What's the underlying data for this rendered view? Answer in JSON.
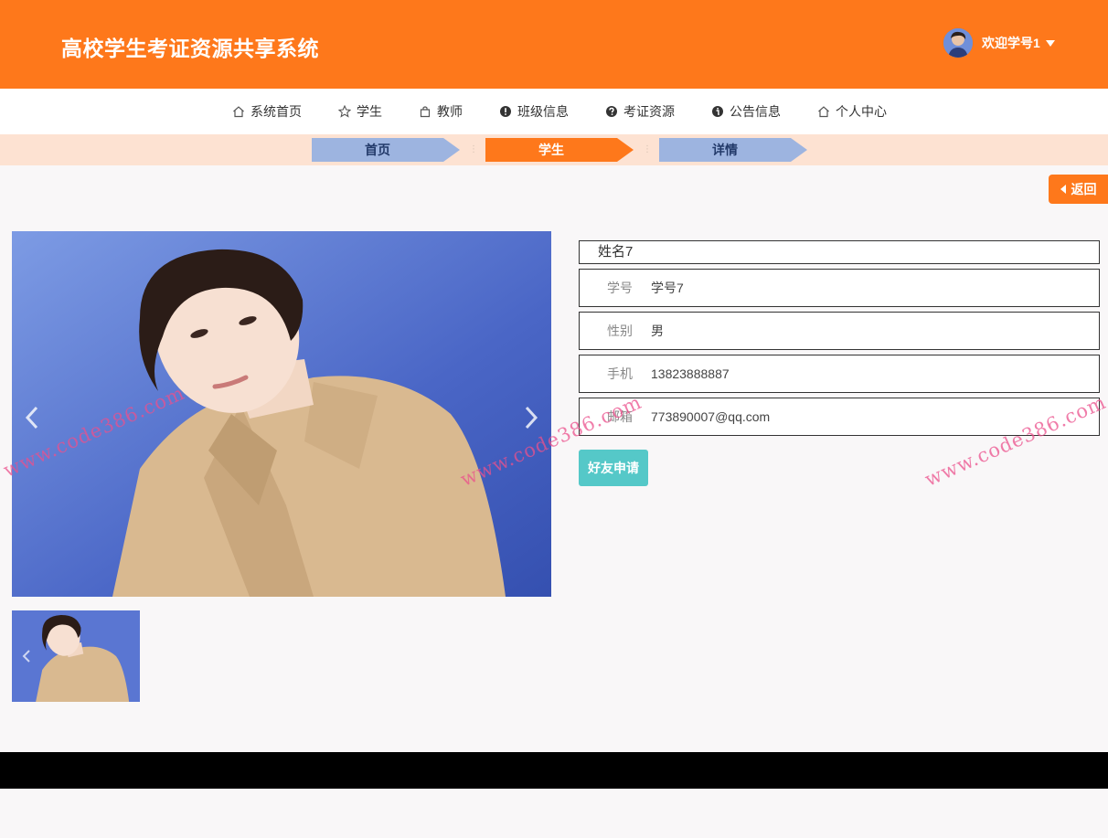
{
  "header": {
    "title": "高校学生考证资源共享系统",
    "welcome": "欢迎学号1"
  },
  "nav": {
    "items": [
      {
        "label": "系统首页",
        "icon": "home-icon"
      },
      {
        "label": "学生",
        "icon": "star-icon"
      },
      {
        "label": "教师",
        "icon": "bag-icon"
      },
      {
        "label": "班级信息",
        "icon": "exclamation-circle-icon"
      },
      {
        "label": "考证资源",
        "icon": "question-circle-icon"
      },
      {
        "label": "公告信息",
        "icon": "info-circle-icon"
      },
      {
        "label": "个人中心",
        "icon": "home-icon"
      }
    ]
  },
  "breadcrumb": {
    "items": [
      "首页",
      "学生",
      "详情"
    ]
  },
  "back_label": "返回",
  "detail": {
    "name": "姓名7",
    "fields": [
      {
        "label": "学号",
        "value": "学号7"
      },
      {
        "label": "性别",
        "value": "男"
      },
      {
        "label": "手机",
        "value": "13823888887"
      },
      {
        "label": "邮箱",
        "value": "773890007@qq.com"
      }
    ],
    "friend_request_label": "好友申请"
  },
  "watermark": "www.code386.com",
  "colors": {
    "primary": "#fe781b",
    "breadcrumb_bg": "#fde2d2",
    "breadcrumb_blue": "#9db4e0",
    "button_teal": "#55c8c8",
    "footer": "#000000"
  }
}
